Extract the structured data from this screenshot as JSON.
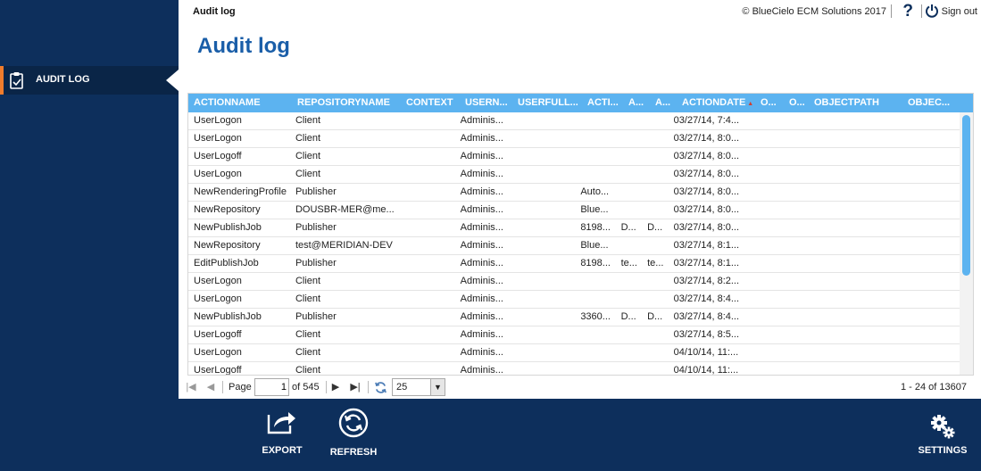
{
  "header": {
    "breadcrumb": "Audit log",
    "copyright": "© BlueCielo ECM Solutions 2017",
    "help_label": "?",
    "signout_label": "Sign out"
  },
  "sidebar": {
    "items": [
      {
        "label": "AUDIT LOG",
        "icon": "clipboard-icon",
        "active": true
      }
    ]
  },
  "page_title": "Audit log",
  "grid": {
    "columns": [
      "ACTIONNAME",
      "REPOSITORYNAME",
      "CONTEXT",
      "USERN...",
      "USERFULL...",
      "ACTI...",
      "A...",
      "A...",
      "ACTIONDATE",
      "O...",
      "O...",
      "OBJECTPATH",
      "OBJEC..."
    ],
    "sorted_column": "ACTIONDATE",
    "rows": [
      [
        "UserLogon",
        "Client",
        "",
        "Adminis...",
        "",
        "",
        "",
        "",
        "03/27/14, 7:4...",
        "",
        "",
        "",
        ""
      ],
      [
        "UserLogon",
        "Client",
        "",
        "Adminis...",
        "",
        "",
        "",
        "",
        "03/27/14, 8:0...",
        "",
        "",
        "",
        ""
      ],
      [
        "UserLogoff",
        "Client",
        "",
        "Adminis...",
        "",
        "",
        "",
        "",
        "03/27/14, 8:0...",
        "",
        "",
        "",
        ""
      ],
      [
        "UserLogon",
        "Client",
        "",
        "Adminis...",
        "",
        "",
        "",
        "",
        "03/27/14, 8:0...",
        "",
        "",
        "",
        ""
      ],
      [
        "NewRenderingProfile",
        "Publisher",
        "",
        "Adminis...",
        "",
        "Auto...",
        "",
        "",
        "03/27/14, 8:0...",
        "",
        "",
        "",
        ""
      ],
      [
        "NewRepository",
        "DOUSBR-MER@me...",
        "",
        "Adminis...",
        "",
        "Blue...",
        "",
        "",
        "03/27/14, 8:0...",
        "",
        "",
        "",
        ""
      ],
      [
        "NewPublishJob",
        "Publisher",
        "",
        "Adminis...",
        "",
        "8198...",
        "D...",
        "D...",
        "03/27/14, 8:0...",
        "",
        "",
        "",
        ""
      ],
      [
        "NewRepository",
        "test@MERIDIAN-DEV",
        "",
        "Adminis...",
        "",
        "Blue...",
        "",
        "",
        "03/27/14, 8:1...",
        "",
        "",
        "",
        ""
      ],
      [
        "EditPublishJob",
        "Publisher",
        "",
        "Adminis...",
        "",
        "8198...",
        "te...",
        "te...",
        "03/27/14, 8:1...",
        "",
        "",
        "",
        ""
      ],
      [
        "UserLogon",
        "Client",
        "",
        "Adminis...",
        "",
        "",
        "",
        "",
        "03/27/14, 8:2...",
        "",
        "",
        "",
        ""
      ],
      [
        "UserLogon",
        "Client",
        "",
        "Adminis...",
        "",
        "",
        "",
        "",
        "03/27/14, 8:4...",
        "",
        "",
        "",
        ""
      ],
      [
        "NewPublishJob",
        "Publisher",
        "",
        "Adminis...",
        "",
        "3360...",
        "D...",
        "D...",
        "03/27/14, 8:4...",
        "",
        "",
        "",
        ""
      ],
      [
        "UserLogoff",
        "Client",
        "",
        "Adminis...",
        "",
        "",
        "",
        "",
        "03/27/14, 8:5...",
        "",
        "",
        "",
        ""
      ],
      [
        "UserLogon",
        "Client",
        "",
        "Adminis...",
        "",
        "",
        "",
        "",
        "04/10/14, 11:...",
        "",
        "",
        "",
        ""
      ],
      [
        "UserLogoff",
        "Client",
        "",
        "Adminis...",
        "",
        "",
        "",
        "",
        "04/10/14, 11:...",
        "",
        "",
        "",
        ""
      ]
    ]
  },
  "pager": {
    "page_label": "Page",
    "page_value": "1",
    "of_pages": "of 545",
    "page_size": "25",
    "total_text": "1 - 24 of 13607"
  },
  "footer": {
    "export_label": "EXPORT",
    "refresh_label": "REFRESH",
    "settings_label": "SETTINGS"
  },
  "colors": {
    "sidebar_bg": "#0d2f5c",
    "grid_header": "#5cb3f0",
    "title": "#1a5ea8",
    "accent": "#f07c2c"
  }
}
